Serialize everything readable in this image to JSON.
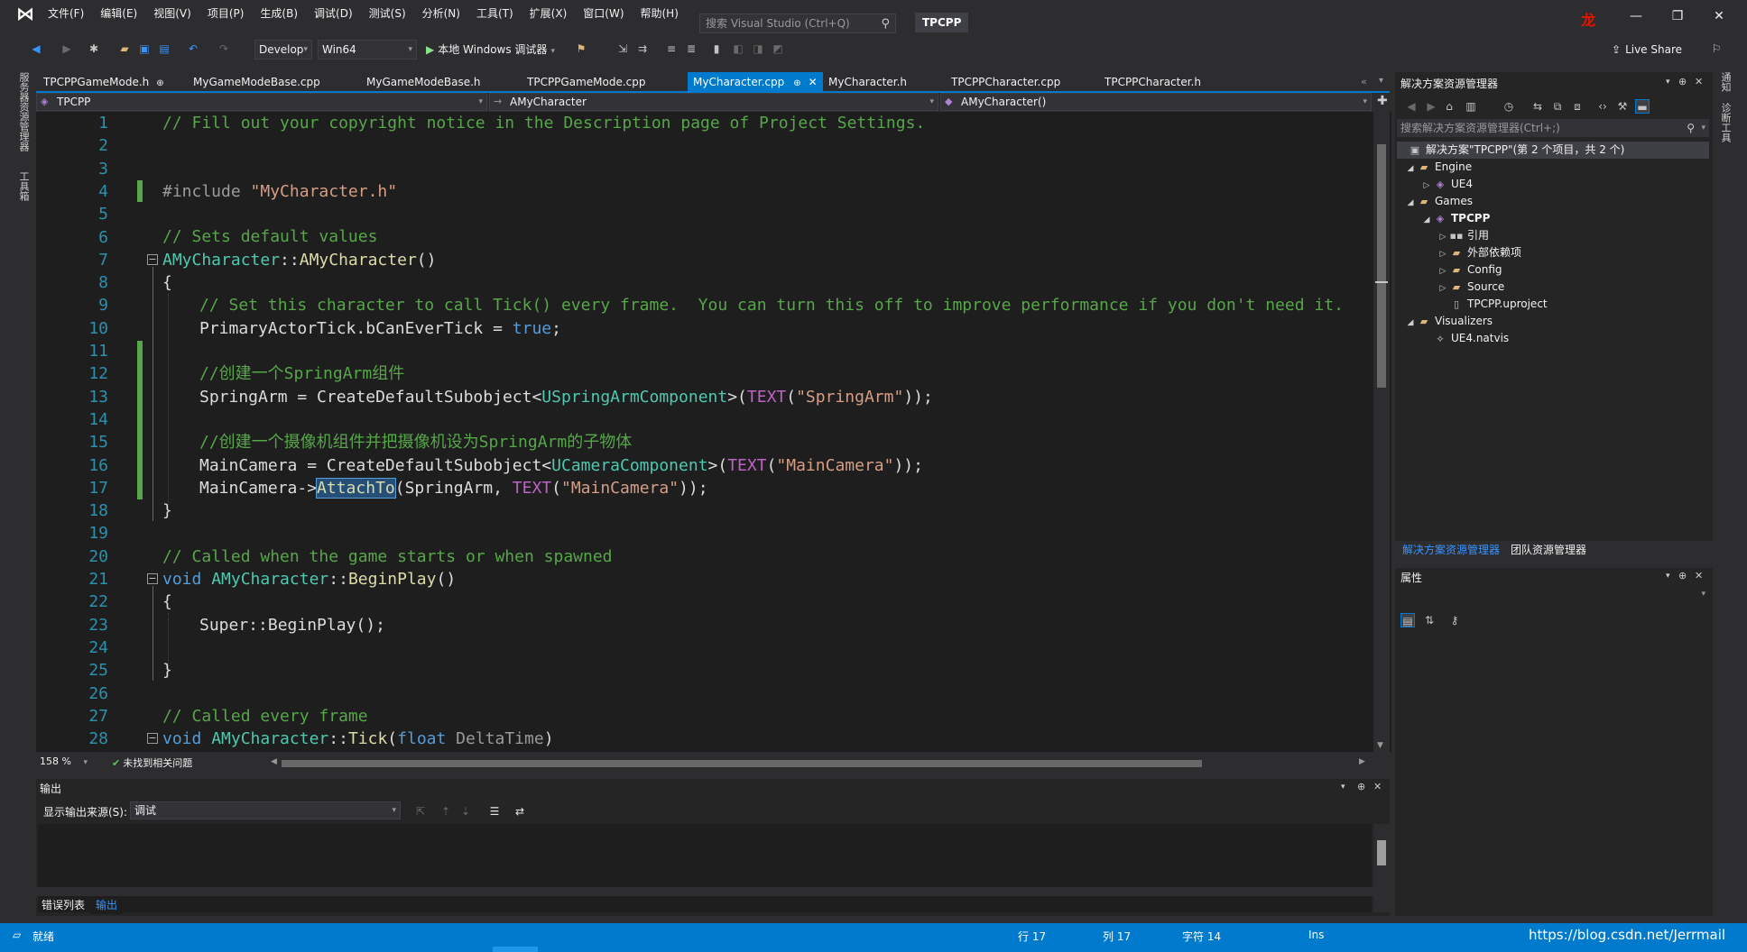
{
  "menubar": {
    "items": [
      "文件(F)",
      "编辑(E)",
      "视图(V)",
      "项目(P)",
      "生成(B)",
      "调试(D)",
      "测试(S)",
      "分析(N)",
      "工具(T)",
      "扩展(X)",
      "窗口(W)",
      "帮助(H)"
    ],
    "search_placeholder": "搜索 Visual Studio (Ctrl+Q)",
    "solution_name": "TPCPP",
    "user_initial": "龙"
  },
  "toolbar": {
    "config": "Develop",
    "platform": "Win64",
    "run_label": "本地 Windows 调试器",
    "live_share": "Live Share"
  },
  "left_strip": {
    "tabs": [
      "服务器资源管理器",
      "工具箱"
    ]
  },
  "right_strip": {
    "tabs": [
      "通知",
      "诊断工具"
    ]
  },
  "editor_tabs": [
    {
      "label": "TPCPPGameMode.h",
      "pinned": true
    },
    {
      "label": "MyGameModeBase.cpp"
    },
    {
      "label": "MyGameModeBase.h"
    },
    {
      "label": "TPCPPGameMode.cpp"
    },
    {
      "label": "MyCharacter.cpp",
      "active": true
    },
    {
      "label": "MyCharacter.h"
    },
    {
      "label": "TPCPPCharacter.cpp"
    },
    {
      "label": "TPCPPCharacter.h"
    }
  ],
  "navbar": {
    "project": "TPCPP",
    "scope": "AMyCharacter",
    "member": "AMyCharacter()"
  },
  "code_lines": [
    "1",
    "2",
    "3",
    "4",
    "5",
    "6",
    "7",
    "8",
    "9",
    "10",
    "11",
    "12",
    "13",
    "14",
    "15",
    "16",
    "17",
    "18",
    "19",
    "20",
    "21",
    "22",
    "23",
    "24",
    "25",
    "26",
    "27",
    "28"
  ],
  "code": {
    "l1": "// Fill out your copyright notice in the Description page of Project Settings.",
    "l4_pp": "#include",
    "l4_str": "\"MyCharacter.h\"",
    "l6": "// Sets default values",
    "l7_a": "AMyCharacter",
    "l7_b": "::",
    "l7_c": "AMyCharacter",
    "l7_d": "()",
    "l8": "{",
    "l9": "// Set this character to call Tick() every frame.  You can turn this off to improve performance if you don't need it.",
    "l10_a": "PrimaryActorTick.bCanEverTick = ",
    "l10_b": "true",
    "l10_c": ";",
    "l12": "//创建一个SpringArm组件",
    "l13_a": "SpringArm = CreateDefaultSubobject<",
    "l13_b": "USpringArmComponent",
    "l13_c": ">(",
    "l13_d": "TEXT",
    "l13_e": "(",
    "l13_f": "\"SpringArm\"",
    "l13_g": "));",
    "l15": "//创建一个摄像机组件并把摄像机设为SpringArm的子物体",
    "l16_a": "MainCamera = CreateDefaultSubobject<",
    "l16_b": "UCameraComponent",
    "l16_c": ">(",
    "l16_d": "TEXT",
    "l16_e": "(",
    "l16_f": "\"MainCamera\"",
    "l16_g": "));",
    "l17_a": "MainCamera->",
    "l17_b": "AttachTo",
    "l17_c": "(SpringArm, ",
    "l17_d": "TEXT",
    "l17_e": "(",
    "l17_f": "\"MainCamera\"",
    "l17_g": "));",
    "l18": "}",
    "l20": "// Called when the game starts or when spawned",
    "l21_a": "void",
    "l21_b": "AMyCharacter",
    "l21_c": "::",
    "l21_d": "BeginPlay",
    "l21_e": "()",
    "l22": "{",
    "l23": "Super::BeginPlay();",
    "l25": "}",
    "l27": "// Called every frame",
    "l28_a": "void",
    "l28_b": "AMyCharacter",
    "l28_c": "::",
    "l28_d": "Tick",
    "l28_e": "(",
    "l28_f": "float",
    "l28_g": " DeltaTime",
    "l28_h": ")"
  },
  "editor_status": {
    "zoom": "158 %",
    "issues": "未找到相关问题"
  },
  "output": {
    "title": "输出",
    "source_label": "显示输出来源(S):",
    "source_value": "调试"
  },
  "bottom_tabs": [
    "错误列表",
    "输出"
  ],
  "solution_explorer": {
    "title": "解决方案资源管理器",
    "search_placeholder": "搜索解决方案资源管理器(Ctrl+;)",
    "tree": [
      {
        "label": "解决方案\"TPCPP\"(第 2 个项目，共 2 个)",
        "level": 0,
        "icon": "solution"
      },
      {
        "label": "Engine",
        "level": 0,
        "icon": "folder",
        "expanded": true
      },
      {
        "label": "UE4",
        "level": 1,
        "icon": "project"
      },
      {
        "label": "Games",
        "level": 0,
        "icon": "folder",
        "expanded": true
      },
      {
        "label": "TPCPP",
        "level": 1,
        "icon": "project",
        "expanded": true
      },
      {
        "label": "引用",
        "level": 2,
        "icon": "refs"
      },
      {
        "label": "外部依赖项",
        "level": 2,
        "icon": "folder"
      },
      {
        "label": "Config",
        "level": 2,
        "icon": "folder"
      },
      {
        "label": "Source",
        "level": 2,
        "icon": "folder"
      },
      {
        "label": "TPCPP.uproject",
        "level": 2,
        "icon": "file"
      },
      {
        "label": "Visualizers",
        "level": 0,
        "icon": "folder",
        "expanded": true
      },
      {
        "label": "UE4.natvis",
        "level": 1,
        "icon": "file"
      }
    ],
    "tabs": [
      "解决方案资源管理器",
      "团队资源管理器"
    ]
  },
  "properties": {
    "title": "属性"
  },
  "statusbar": {
    "ready": "就绪",
    "line": "行 17",
    "col": "列 17",
    "char": "字符 14",
    "mode": "Ins",
    "right_text": "https://blog.csdn.net/Jerrmail"
  },
  "colors": {
    "accent": "#007acc",
    "comment": "#57a64a",
    "keyword": "#569cd6",
    "string": "#d69d85",
    "type": "#4ec9b0",
    "macro": "#bd63c5"
  }
}
